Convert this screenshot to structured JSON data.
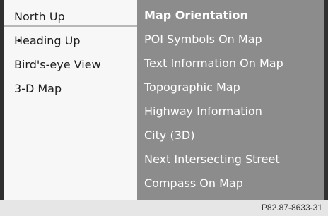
{
  "options": [
    {
      "label": "North Up",
      "selected": true
    },
    {
      "label": "Heading Up",
      "marker": "•"
    },
    {
      "label": "Bird's-eye View"
    },
    {
      "label": "3-D Map"
    }
  ],
  "menu": [
    {
      "label": "Map Orientation",
      "active": true
    },
    {
      "label": "POI Symbols On Map"
    },
    {
      "label": "Text Information On Map"
    },
    {
      "label": "Topographic Map"
    },
    {
      "label": "Highway Information"
    },
    {
      "label": "City (3D)"
    },
    {
      "label": "Next Intersecting Street"
    },
    {
      "label": "Compass On Map"
    }
  ],
  "footer": {
    "code": "P82.87-8633-31"
  },
  "colors": {
    "menu_bg": "#8c8c8c",
    "options_bg": "#f7f7f7"
  }
}
